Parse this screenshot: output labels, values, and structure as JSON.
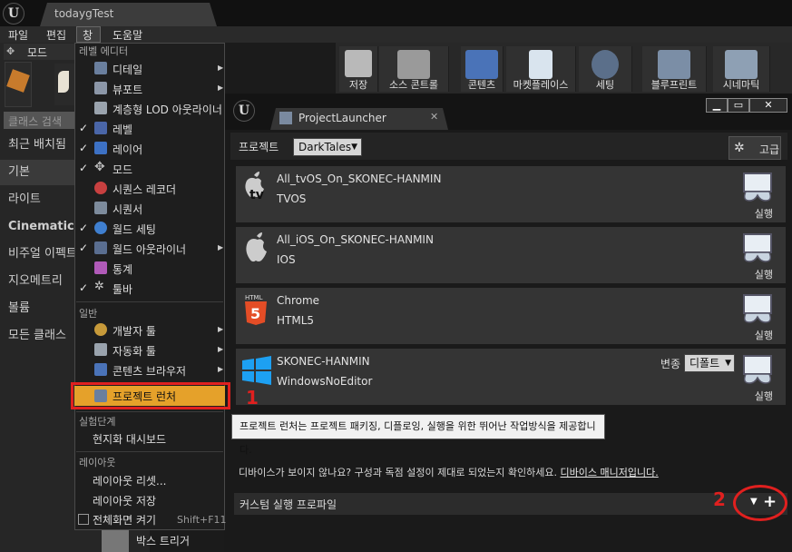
{
  "app": {
    "tab_title": "todaygTest",
    "menu": [
      "파일",
      "편집",
      "창",
      "도움말"
    ]
  },
  "left_panel": {
    "modes_tab": "모드",
    "search_placeholder": "클래스 검색",
    "categories": [
      "최근 배치됨",
      "기본",
      "라이트",
      "Cinematic",
      "비주얼 이펙트",
      "지오메트리",
      "볼륨",
      "모든 클래스"
    ],
    "bottom_item": "박스 트리거"
  },
  "toolbar": {
    "buttons": [
      "저장",
      "소스 콘트롤",
      "콘텐츠",
      "마켓플레이스",
      "세팅",
      "블루프린트",
      "시네마틱"
    ]
  },
  "window_menu": {
    "section_level_editor": "레벨 에디터",
    "level_editor_items": [
      {
        "label": "디테일",
        "checked": false,
        "submenu": true
      },
      {
        "label": "뷰포트",
        "checked": false,
        "submenu": true
      },
      {
        "label": "계층형 LOD 아웃라이너",
        "checked": false,
        "submenu": false
      },
      {
        "label": "레벨",
        "checked": true,
        "submenu": false
      },
      {
        "label": "레이어",
        "checked": true,
        "submenu": false
      },
      {
        "label": "모드",
        "checked": true,
        "submenu": false
      },
      {
        "label": "시퀀스 레코더",
        "checked": false,
        "submenu": false
      },
      {
        "label": "시퀀서",
        "checked": false,
        "submenu": false
      },
      {
        "label": "월드 세팅",
        "checked": true,
        "submenu": false
      },
      {
        "label": "월드 아웃라이너",
        "checked": true,
        "submenu": true
      },
      {
        "label": "통계",
        "checked": false,
        "submenu": false
      },
      {
        "label": "툴바",
        "checked": true,
        "submenu": false
      }
    ],
    "section_general": "일반",
    "general_items": [
      {
        "label": "개발자 툴",
        "submenu": true
      },
      {
        "label": "자동화 툴",
        "submenu": true
      },
      {
        "label": "콘텐츠 브라우저",
        "submenu": true
      },
      {
        "label": "프로젝트 런처",
        "submenu": false
      }
    ],
    "section_experimental": "실험단계",
    "experimental_items": [
      "현지화 대시보드"
    ],
    "section_layout": "레이아웃",
    "layout_items": [
      "레이아웃 리셋...",
      "레이아웃 저장"
    ],
    "fullscreen_label": "전체화면 켜기",
    "fullscreen_shortcut": "Shift+F11"
  },
  "annotations": {
    "marker1": "1",
    "marker2": "2",
    "highlight_color": "#e0201f"
  },
  "launcher": {
    "tab_title": "ProjectLauncher",
    "project_label": "프로젝트",
    "project_value": "DarkTales",
    "advanced_label": "고급",
    "devices": [
      {
        "name": "All_tvOS_On_SKONEC-HANMIN",
        "platform": "TVOS",
        "run": "실행",
        "icon": "apple-tv-icon"
      },
      {
        "name": "All_iOS_On_SKONEC-HANMIN",
        "platform": "IOS",
        "run": "실행",
        "icon": "apple-icon"
      },
      {
        "name": "Chrome",
        "platform": "HTML5",
        "run": "실행",
        "icon": "html5-icon"
      },
      {
        "name": "SKONEC-HANMIN",
        "platform": "WindowsNoEditor",
        "run": "실행",
        "icon": "windows-icon",
        "variant_label": "변종",
        "variant_value": "디폴트"
      }
    ],
    "tooltip": "프로젝트 런처는 프로젝트 패키징, 디플로잉, 실행을 위한 뛰어난 작업방식을 제공합니다.",
    "help_text": "디바이스가 보이지 않나요? 구성과 독점 설정이 제대로 되었는지 확인하세요.",
    "help_link": "디바이스 매니저입니다.",
    "custom_profile_label": "커스텀 실행 프로파일"
  }
}
